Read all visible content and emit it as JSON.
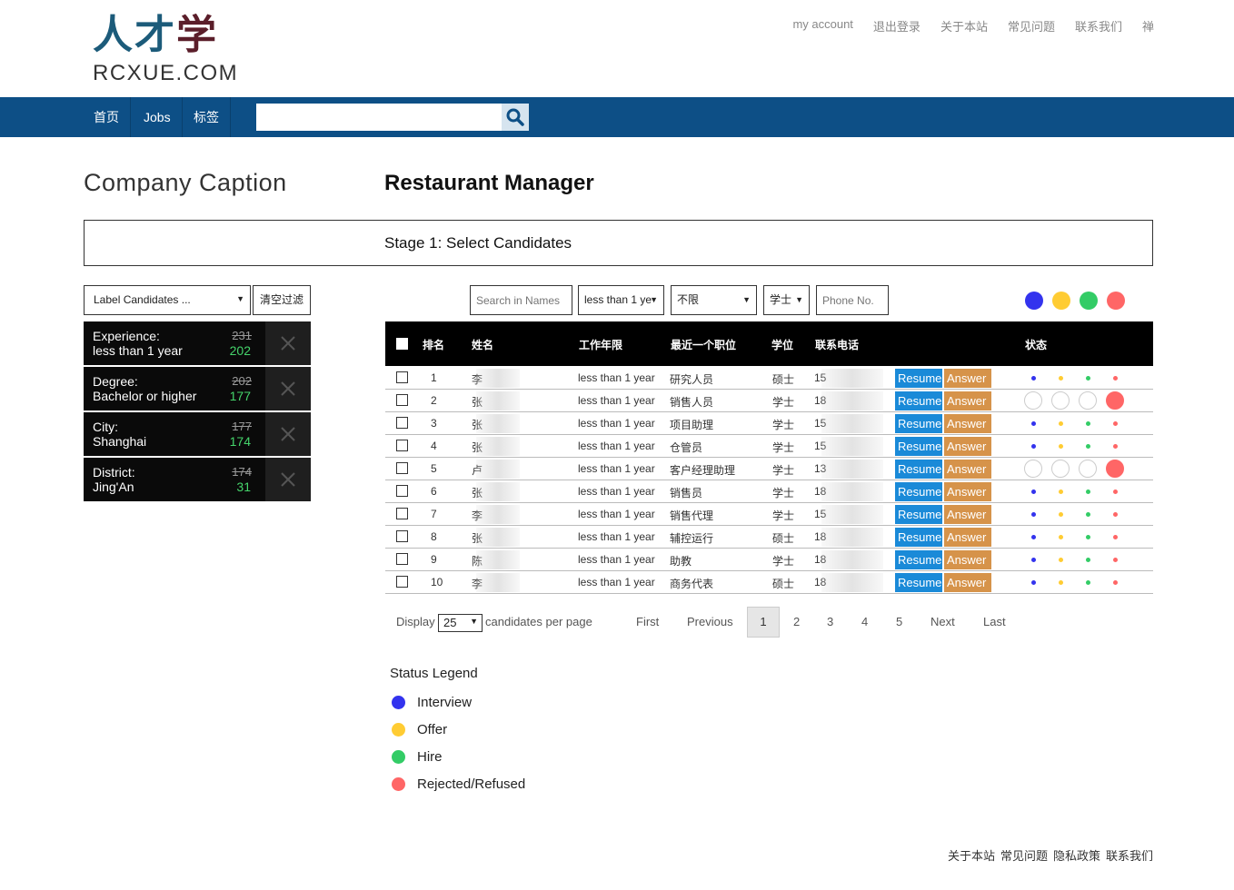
{
  "logo": {
    "cn1": "人才",
    "cn2": "学",
    "en": "RCXUE.COM"
  },
  "topnav": [
    "my account",
    "退出登录",
    "关于本站",
    "常见问题",
    "联系我们",
    "禅"
  ],
  "navbar": {
    "items": [
      "首页",
      "Jobs",
      "标签"
    ],
    "search_value": ""
  },
  "company": "Company Caption",
  "job_title": "Restaurant Manager",
  "stage": "Stage 1: Select Candidates",
  "filters": {
    "label_select": "Label Candidates ...",
    "clear": "清空过滤",
    "items": [
      {
        "line1": "Experience:",
        "line2": "less than 1 year",
        "old": "231",
        "new": "202"
      },
      {
        "line1": "Degree:",
        "line2": "Bachelor or higher",
        "old": "202",
        "new": "177"
      },
      {
        "line1": "City:",
        "line2": "Shanghai",
        "old": "177",
        "new": "174"
      },
      {
        "line1": "District:",
        "line2": "Jing'An",
        "old": "174",
        "new": "31"
      }
    ]
  },
  "controls": {
    "search_names_placeholder": "Search in Names",
    "experience": "less than 1 ye",
    "position": "不限",
    "degree": "学士",
    "phone_placeholder": "Phone No."
  },
  "colors": {
    "interview": "#3333ee",
    "offer": "#ffcc33",
    "hire": "#33cc66",
    "rejected": "#ff6666"
  },
  "table": {
    "headers": [
      "排名",
      "姓名",
      "工作年限",
      "最近一个职位",
      "学位",
      "联系电话",
      "状态"
    ],
    "resume_label": "Resume",
    "answer_label": "Answer",
    "rows": [
      {
        "rank": "1",
        "name": "李",
        "exp": "less than 1 year",
        "pos": "研究人员",
        "deg": "硕士",
        "phone": "15",
        "mode": "small"
      },
      {
        "rank": "2",
        "name": "张",
        "exp": "less than 1 year",
        "pos": "销售人员",
        "deg": "学士",
        "phone": "18",
        "mode": "rejected"
      },
      {
        "rank": "3",
        "name": "张",
        "exp": "less than 1 year",
        "pos": "项目助理",
        "deg": "学士",
        "phone": "15",
        "mode": "small"
      },
      {
        "rank": "4",
        "name": "张",
        "exp": "less than 1 year",
        "pos": "仓管员",
        "deg": "学士",
        "phone": "15",
        "mode": "small"
      },
      {
        "rank": "5",
        "name": "卢",
        "exp": "less than 1 year",
        "pos": "客户经理助理",
        "deg": "学士",
        "phone": "13",
        "mode": "rejected"
      },
      {
        "rank": "6",
        "name": "张",
        "exp": "less than 1 year",
        "pos": "销售员",
        "deg": "学士",
        "phone": "18",
        "mode": "small"
      },
      {
        "rank": "7",
        "name": "李",
        "exp": "less than 1 year",
        "pos": "销售代理",
        "deg": "学士",
        "phone": "15",
        "mode": "small"
      },
      {
        "rank": "8",
        "name": "张",
        "exp": "less than 1 year",
        "pos": "辅控运行",
        "deg": "硕士",
        "phone": "18",
        "mode": "small"
      },
      {
        "rank": "9",
        "name": "陈",
        "exp": "less than 1 year",
        "pos": "助教",
        "deg": "学士",
        "phone": "18",
        "mode": "small"
      },
      {
        "rank": "10",
        "name": "李",
        "exp": "less than 1 year",
        "pos": "商务代表",
        "deg": "硕士",
        "phone": "18",
        "mode": "small"
      }
    ]
  },
  "pagination": {
    "display": "Display",
    "per_page_value": "25",
    "per_page_text": "candidates per page",
    "first": "First",
    "previous": "Previous",
    "pages": [
      "1",
      "2",
      "3",
      "4",
      "5"
    ],
    "current": "1",
    "next": "Next",
    "last": "Last"
  },
  "legend": {
    "title": "Status Legend",
    "items": [
      "Interview",
      "Offer",
      "Hire",
      "Rejected/Refused"
    ]
  },
  "footer": [
    "关于本站",
    "常见问题",
    "隐私政策",
    "联系我们"
  ]
}
